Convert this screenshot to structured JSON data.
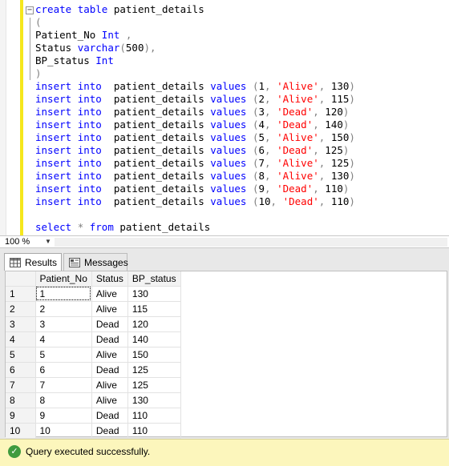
{
  "editor": {
    "lines": [
      [
        {
          "t": "create",
          "c": "kw"
        },
        {
          "t": " "
        },
        {
          "t": "table",
          "c": "kw"
        },
        {
          "t": " patient_details"
        }
      ],
      [
        {
          "t": "(",
          "c": "gray"
        }
      ],
      [
        {
          "t": "Patient_No "
        },
        {
          "t": "Int",
          "c": "kw"
        },
        {
          "t": " ,",
          "c": "gray"
        }
      ],
      [
        {
          "t": "Status "
        },
        {
          "t": "varchar",
          "c": "kw"
        },
        {
          "t": "(",
          "c": "gray"
        },
        {
          "t": "500"
        },
        {
          "t": "),",
          "c": "gray"
        }
      ],
      [
        {
          "t": "BP_status "
        },
        {
          "t": "Int",
          "c": "kw"
        }
      ],
      [
        {
          "t": ")",
          "c": "gray"
        }
      ],
      [
        {
          "t": "insert",
          "c": "kw"
        },
        {
          "t": " "
        },
        {
          "t": "into",
          "c": "kw"
        },
        {
          "t": "  patient_details "
        },
        {
          "t": "values",
          "c": "kw"
        },
        {
          "t": " (",
          "c": "gray"
        },
        {
          "t": "1"
        },
        {
          "t": ",",
          "c": "gray"
        },
        {
          "t": " "
        },
        {
          "t": "'Alive'",
          "c": "str"
        },
        {
          "t": ",",
          "c": "gray"
        },
        {
          "t": " 130"
        },
        {
          "t": ")",
          "c": "gray"
        }
      ],
      [
        {
          "t": "insert",
          "c": "kw"
        },
        {
          "t": " "
        },
        {
          "t": "into",
          "c": "kw"
        },
        {
          "t": "  patient_details "
        },
        {
          "t": "values",
          "c": "kw"
        },
        {
          "t": " (",
          "c": "gray"
        },
        {
          "t": "2"
        },
        {
          "t": ",",
          "c": "gray"
        },
        {
          "t": " "
        },
        {
          "t": "'Alive'",
          "c": "str"
        },
        {
          "t": ",",
          "c": "gray"
        },
        {
          "t": " 115"
        },
        {
          "t": ")",
          "c": "gray"
        }
      ],
      [
        {
          "t": "insert",
          "c": "kw"
        },
        {
          "t": " "
        },
        {
          "t": "into",
          "c": "kw"
        },
        {
          "t": "  patient_details "
        },
        {
          "t": "values",
          "c": "kw"
        },
        {
          "t": " (",
          "c": "gray"
        },
        {
          "t": "3"
        },
        {
          "t": ",",
          "c": "gray"
        },
        {
          "t": " "
        },
        {
          "t": "'Dead'",
          "c": "str"
        },
        {
          "t": ",",
          "c": "gray"
        },
        {
          "t": " 120"
        },
        {
          "t": ")",
          "c": "gray"
        }
      ],
      [
        {
          "t": "insert",
          "c": "kw"
        },
        {
          "t": " "
        },
        {
          "t": "into",
          "c": "kw"
        },
        {
          "t": "  patient_details "
        },
        {
          "t": "values",
          "c": "kw"
        },
        {
          "t": " (",
          "c": "gray"
        },
        {
          "t": "4"
        },
        {
          "t": ",",
          "c": "gray"
        },
        {
          "t": " "
        },
        {
          "t": "'Dead'",
          "c": "str"
        },
        {
          "t": ",",
          "c": "gray"
        },
        {
          "t": " 140"
        },
        {
          "t": ")",
          "c": "gray"
        }
      ],
      [
        {
          "t": "insert",
          "c": "kw"
        },
        {
          "t": " "
        },
        {
          "t": "into",
          "c": "kw"
        },
        {
          "t": "  patient_details "
        },
        {
          "t": "values",
          "c": "kw"
        },
        {
          "t": " (",
          "c": "gray"
        },
        {
          "t": "5"
        },
        {
          "t": ",",
          "c": "gray"
        },
        {
          "t": " "
        },
        {
          "t": "'Alive'",
          "c": "str"
        },
        {
          "t": ",",
          "c": "gray"
        },
        {
          "t": " 150"
        },
        {
          "t": ")",
          "c": "gray"
        }
      ],
      [
        {
          "t": "insert",
          "c": "kw"
        },
        {
          "t": " "
        },
        {
          "t": "into",
          "c": "kw"
        },
        {
          "t": "  patient_details "
        },
        {
          "t": "values",
          "c": "kw"
        },
        {
          "t": " (",
          "c": "gray"
        },
        {
          "t": "6"
        },
        {
          "t": ",",
          "c": "gray"
        },
        {
          "t": " "
        },
        {
          "t": "'Dead'",
          "c": "str"
        },
        {
          "t": ",",
          "c": "gray"
        },
        {
          "t": " 125"
        },
        {
          "t": ")",
          "c": "gray"
        }
      ],
      [
        {
          "t": "insert",
          "c": "kw"
        },
        {
          "t": " "
        },
        {
          "t": "into",
          "c": "kw"
        },
        {
          "t": "  patient_details "
        },
        {
          "t": "values",
          "c": "kw"
        },
        {
          "t": " (",
          "c": "gray"
        },
        {
          "t": "7"
        },
        {
          "t": ",",
          "c": "gray"
        },
        {
          "t": " "
        },
        {
          "t": "'Alive'",
          "c": "str"
        },
        {
          "t": ",",
          "c": "gray"
        },
        {
          "t": " 125"
        },
        {
          "t": ")",
          "c": "gray"
        }
      ],
      [
        {
          "t": "insert",
          "c": "kw"
        },
        {
          "t": " "
        },
        {
          "t": "into",
          "c": "kw"
        },
        {
          "t": "  patient_details "
        },
        {
          "t": "values",
          "c": "kw"
        },
        {
          "t": " (",
          "c": "gray"
        },
        {
          "t": "8"
        },
        {
          "t": ",",
          "c": "gray"
        },
        {
          "t": " "
        },
        {
          "t": "'Alive'",
          "c": "str"
        },
        {
          "t": ",",
          "c": "gray"
        },
        {
          "t": " 130"
        },
        {
          "t": ")",
          "c": "gray"
        }
      ],
      [
        {
          "t": "insert",
          "c": "kw"
        },
        {
          "t": " "
        },
        {
          "t": "into",
          "c": "kw"
        },
        {
          "t": "  patient_details "
        },
        {
          "t": "values",
          "c": "kw"
        },
        {
          "t": " (",
          "c": "gray"
        },
        {
          "t": "9"
        },
        {
          "t": ",",
          "c": "gray"
        },
        {
          "t": " "
        },
        {
          "t": "'Dead'",
          "c": "str"
        },
        {
          "t": ",",
          "c": "gray"
        },
        {
          "t": " 110"
        },
        {
          "t": ")",
          "c": "gray"
        }
      ],
      [
        {
          "t": "insert",
          "c": "kw"
        },
        {
          "t": " "
        },
        {
          "t": "into",
          "c": "kw"
        },
        {
          "t": "  patient_details "
        },
        {
          "t": "values",
          "c": "kw"
        },
        {
          "t": " (",
          "c": "gray"
        },
        {
          "t": "10"
        },
        {
          "t": ",",
          "c": "gray"
        },
        {
          "t": " "
        },
        {
          "t": "'Dead'",
          "c": "str"
        },
        {
          "t": ",",
          "c": "gray"
        },
        {
          "t": " 110"
        },
        {
          "t": ")",
          "c": "gray"
        }
      ],
      [],
      [
        {
          "t": "select",
          "c": "kw"
        },
        {
          "t": " "
        },
        {
          "t": "*",
          "c": "gray"
        },
        {
          "t": " "
        },
        {
          "t": "from",
          "c": "kw"
        },
        {
          "t": " patient_details"
        }
      ]
    ]
  },
  "zoom": {
    "level": "100 %"
  },
  "tabs": {
    "results": "Results",
    "messages": "Messages"
  },
  "grid": {
    "columns": [
      "Patient_No",
      "Status",
      "BP_status"
    ],
    "rows": [
      [
        "1",
        "1",
        "Alive",
        "130"
      ],
      [
        "2",
        "2",
        "Alive",
        "115"
      ],
      [
        "3",
        "3",
        "Dead",
        "120"
      ],
      [
        "4",
        "4",
        "Dead",
        "140"
      ],
      [
        "5",
        "5",
        "Alive",
        "150"
      ],
      [
        "6",
        "6",
        "Dead",
        "125"
      ],
      [
        "7",
        "7",
        "Alive",
        "125"
      ],
      [
        "8",
        "8",
        "Alive",
        "130"
      ],
      [
        "9",
        "9",
        "Dead",
        "110"
      ],
      [
        "10",
        "10",
        "Dead",
        "110"
      ]
    ]
  },
  "status": {
    "text": "Query executed successfully.",
    "icon": "checkmark-icon"
  },
  "colors": {
    "keyword": "#0000ff",
    "string": "#ff0000",
    "operator": "#808080",
    "status_bg": "#fcf6bc"
  }
}
